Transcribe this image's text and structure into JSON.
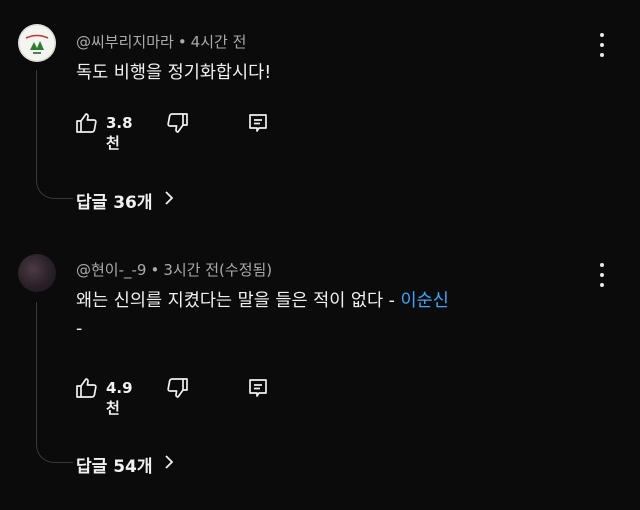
{
  "comments": [
    {
      "author": "@씨부리지마라",
      "time": "4시간 전",
      "text": "독도 비행을 정기화합시다!",
      "likes": "3.8천",
      "replies_label": "답글 36개"
    },
    {
      "author": "@현이-_-9",
      "time": "3시간 전(수정됨)",
      "text": "왜는 신의를 지켰다는 말을 들은 적이 없다 - ",
      "text_link": "이순신",
      "text_tail": "-",
      "likes": "4.9천",
      "replies_label": "답글 54개"
    }
  ],
  "meta_separator": "•",
  "icons": {
    "like": "thumbs-up-icon",
    "dislike": "thumbs-down-icon",
    "reply": "reply-comment-icon",
    "more": "more-vert-icon",
    "chevron": "chevron-right-icon"
  },
  "colors": {
    "background": "#0b0b0b",
    "text": "#f1f1f1",
    "secondary": "#aaaaaa",
    "link": "#3ea6ff"
  }
}
